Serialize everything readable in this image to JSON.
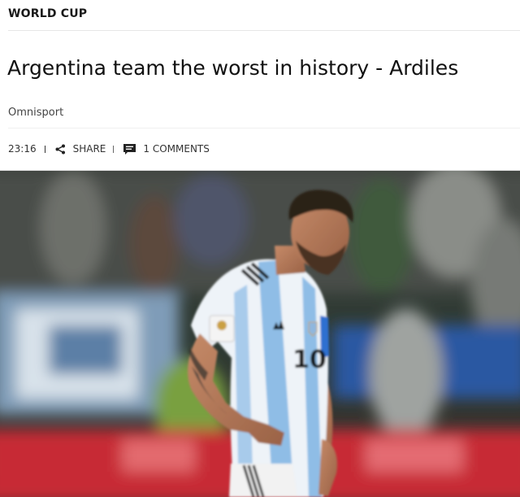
{
  "category": "WORLD CUP",
  "headline": "Argentina team the worst in history - Ardiles",
  "author": "Omnisport",
  "meta": {
    "time": "23:16",
    "share_label": "SHARE",
    "comments_label": "1 COMMENTS",
    "share_icon": "share-icon",
    "comment_icon": "comment-icon"
  },
  "image": {
    "subject": "player in blue-and-white striped jersey number 10, head bowed",
    "jersey_number": "10",
    "colors": {
      "stripe_blue": "#8fbde6",
      "sleeve_band": "#2f6fd0",
      "crowd_red": "#c72b35"
    }
  }
}
